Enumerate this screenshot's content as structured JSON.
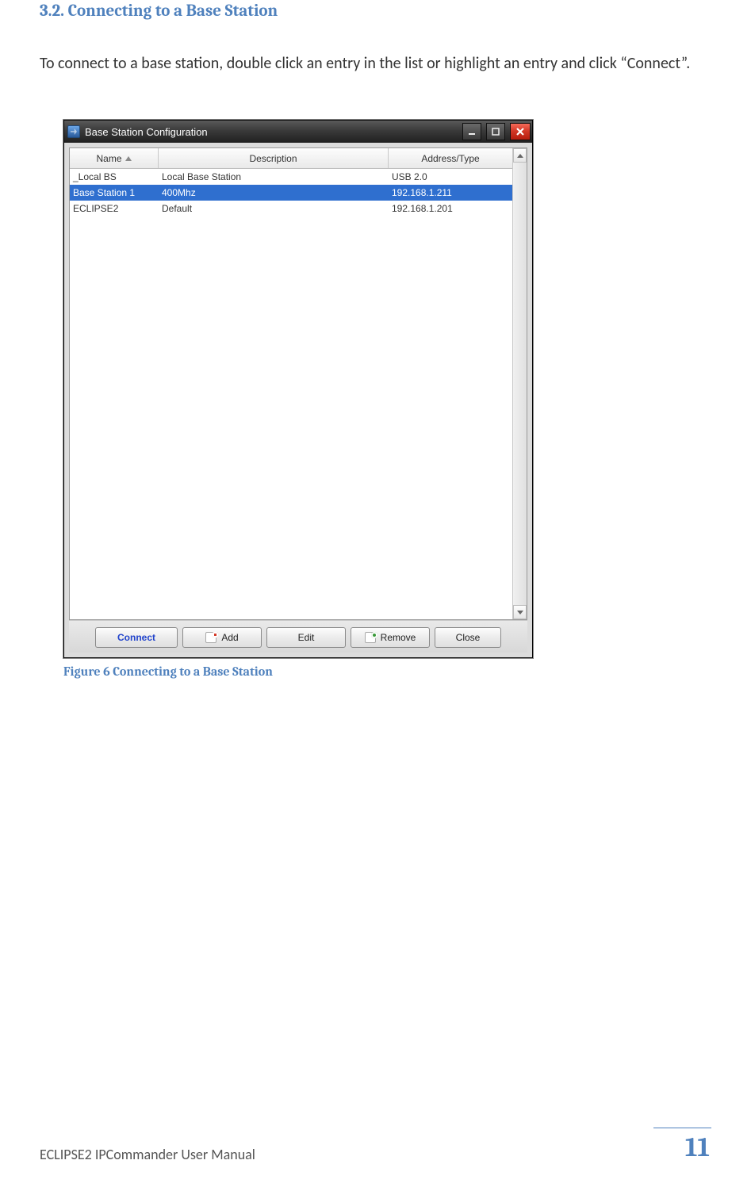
{
  "section": {
    "heading": "3.2. Connecting to a Base Station"
  },
  "body": {
    "para": "To connect to a base station, double click an entry in the list or highlight an entry and click “Connect”."
  },
  "window": {
    "title": "Base Station Configuration",
    "columns": {
      "name": "Name",
      "desc": "Description",
      "addr": "Address/Type"
    },
    "rows": [
      {
        "name": "_Local BS",
        "desc": "Local Base Station",
        "addr": "USB 2.0",
        "selected": false
      },
      {
        "name": "Base Station 1",
        "desc": "400Mhz",
        "addr": "192.168.1.211",
        "selected": true
      },
      {
        "name": "ECLIPSE2",
        "desc": "Default",
        "addr": "192.168.1.201",
        "selected": false
      }
    ],
    "buttons": {
      "connect": "Connect",
      "add": "Add",
      "edit": "Edit",
      "remove": "Remove",
      "close": "Close"
    }
  },
  "figure": {
    "caption": "Figure 6 Connecting to a Base Station"
  },
  "footer": {
    "doc": "ECLIPSE2 IPCommander User Manual",
    "page": "11"
  }
}
